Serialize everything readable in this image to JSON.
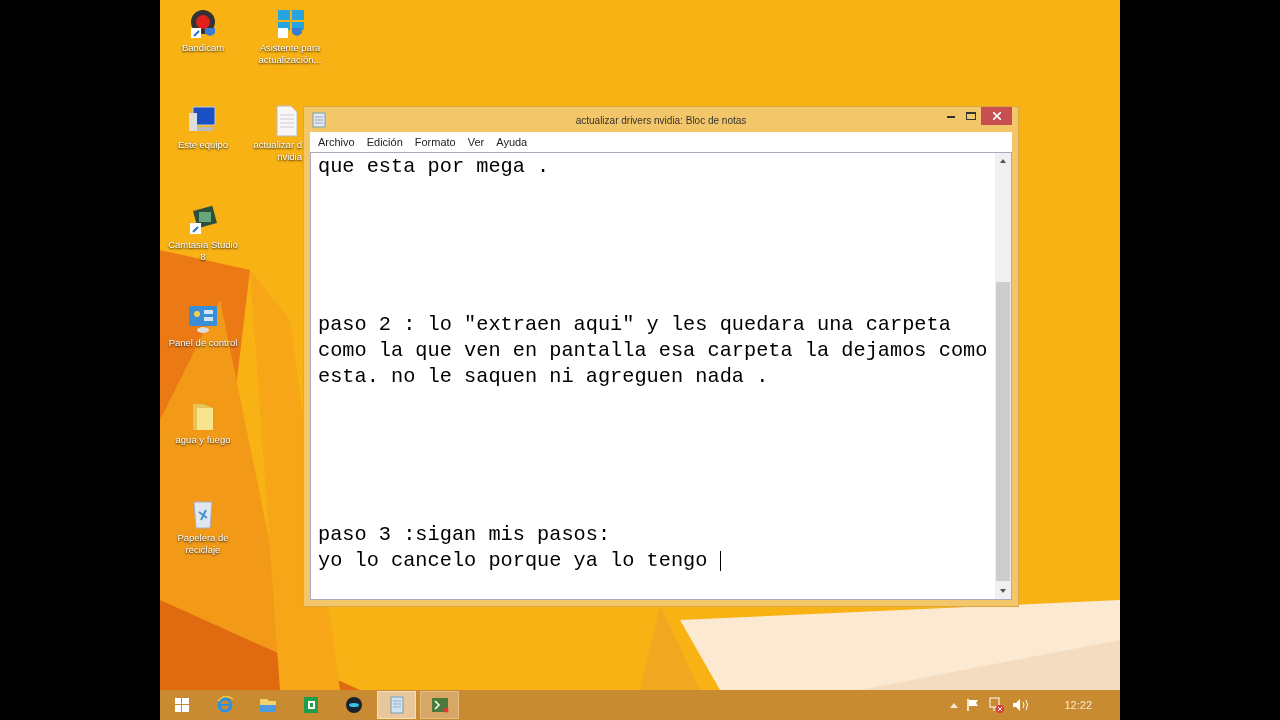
{
  "desktop_icons": [
    {
      "kind": "recorder",
      "label": "Bandicam"
    },
    {
      "kind": "update",
      "label": "Asistente para\nactualización..."
    },
    {
      "kind": "computer",
      "label": "Este equipo"
    },
    {
      "kind": "document",
      "label": "actualizar d\nnvidia"
    },
    {
      "kind": "camtasia",
      "label": "Camtasia Studio\n8"
    },
    {
      "kind": "control",
      "label": "Panel de control"
    },
    {
      "kind": "folder",
      "label": "agua y fuego"
    },
    {
      "kind": "bin",
      "label": "Papelera de\nreciclaje"
    }
  ],
  "window": {
    "title": "actualizar drivers nvidia: Bloc de notas",
    "menu": [
      "Archivo",
      "Edición",
      "Formato",
      "Ver",
      "Ayuda"
    ],
    "text": "que esta por mega .\n\n\n\n\n\npaso 2 : lo \"extraen aqui\" y les quedara una carpeta\ncomo la que ven en pantalla esa carpeta la dejamos como\nesta. no le saquen ni agreguen nada .\n\n\n\n\n\npaso 3 :sigan mis pasos:\nyo lo cancelo porque ya lo tengo "
  },
  "taskbar": {
    "items": [
      {
        "kind": "start",
        "selected": false
      },
      {
        "kind": "browser",
        "selected": false
      },
      {
        "kind": "explorer",
        "selected": false
      },
      {
        "kind": "sheet",
        "selected": false
      },
      {
        "kind": "emulator",
        "selected": false
      },
      {
        "kind": "notepad",
        "selected": true
      },
      {
        "kind": "terminal",
        "selected": false
      }
    ],
    "clock": "12:22"
  }
}
